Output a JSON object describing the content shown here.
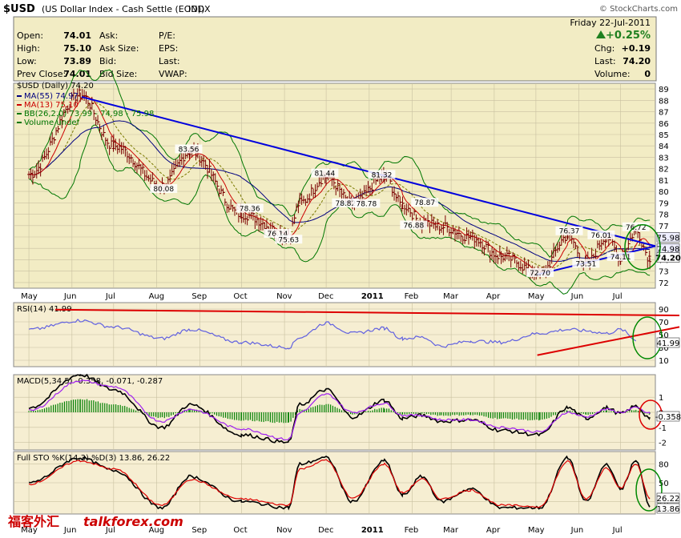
{
  "header": {
    "symbol": "$USD",
    "description": "(US Dollar Index - Cash Settle (EOD))",
    "exchange": "INDX",
    "watermark": "© StockCharts.com",
    "date": "Friday   22-Jul-2011",
    "change_pct": "+0.25%",
    "quote_left": [
      {
        "label": "Open:",
        "value": "74.01"
      },
      {
        "label": "High:",
        "value": "75.10"
      },
      {
        "label": "Low:",
        "value": "73.89"
      },
      {
        "label": "Prev Close:",
        "value": "74.01"
      }
    ],
    "quote_mid": [
      "Ask:",
      "Ask Size:",
      "Bid:",
      "Bid Size:"
    ],
    "quote_mid2": [
      "P/E:",
      "EPS:",
      "Last:",
      "VWAP:"
    ],
    "quote_right": [
      {
        "label": "Chg:",
        "value": "+0.19"
      },
      {
        "label": "Last:",
        "value": "74.20"
      },
      {
        "label": "Volume:",
        "value": "0"
      }
    ]
  },
  "colors": {
    "price_bg": "#f2ecc4",
    "ind_bg": "#f6eed2",
    "bar": "#7a0000",
    "trend_blue": "#0000dd",
    "trend_red": "#dd0000",
    "circle_green": "#008800",
    "circle_red": "#dd0000",
    "ma55": "#000080",
    "ma13": "#cc0000",
    "bb": "#007700",
    "bb_mid": "#7a7a00",
    "rsi": "#6060e0",
    "macd": "#000000",
    "macd_signal": "#a020f0",
    "macd_hist": "#008000",
    "sto_k": "#000000",
    "sto_d": "#dd0000",
    "footer_text": "#cc0000",
    "footer_text2": "#006600"
  },
  "footer": {
    "brand_cn": "福客外汇",
    "brand_en": "talkforex.com"
  },
  "chart_data": [
    {
      "type": "line",
      "title": "$USD (Daily) 74.20",
      "legend": [
        "MA(55) 74.97",
        "MA(13) 75.10",
        "BB(26,2.0) 73.99 - 74.98 - 75.98",
        "Volume undef"
      ],
      "months": [
        "May",
        "Jun",
        "Jul",
        "Aug",
        "Sep",
        "Oct",
        "Nov",
        "Dec",
        "2011",
        "Feb",
        "Mar",
        "Apr",
        "May",
        "Jun",
        "Jul"
      ],
      "y_ticks": [
        72,
        73,
        74,
        75,
        76,
        77,
        78,
        79,
        80,
        81,
        82,
        83,
        84,
        85,
        86,
        87,
        88,
        89
      ],
      "ylim": [
        71.5,
        89.5
      ],
      "series": [
        {
          "name": "$USD (Daily)",
          "x": [
            "2010-05-01",
            "2010-06-07",
            "2010-07-01",
            "2010-08-05",
            "2010-08-25",
            "2010-10-01",
            "2010-11-04",
            "2010-11-12",
            "2010-12-01",
            "2010-12-20",
            "2011-01-12",
            "2011-01-25",
            "2011-02-08",
            "2011-02-22",
            "2011-03-15",
            "2011-04-06",
            "2011-05-04",
            "2011-05-24",
            "2011-06-06",
            "2011-06-21",
            "2011-07-01",
            "2011-07-12",
            "2011-07-22"
          ],
          "values": [
            81.5,
            88.5,
            84,
            80.5,
            83.5,
            78,
            76.2,
            79,
            81.3,
            78.9,
            81.3,
            78.8,
            77.3,
            76.9,
            76.0,
            74.3,
            72.8,
            76.1,
            73.6,
            76.0,
            74.2,
            76.5,
            74.2
          ]
        }
      ],
      "annotations": [
        {
          "text": "83.56",
          "x": "2010-08-24",
          "y": 83.56
        },
        {
          "text": "80.08",
          "x": "2010-08-06",
          "y": 80.08
        },
        {
          "text": "78.36",
          "x": "2010-10-07",
          "y": 78.36
        },
        {
          "text": "76.14",
          "x": "2010-10-27",
          "y": 76.14
        },
        {
          "text": "75.63",
          "x": "2010-11-04",
          "y": 75.63
        },
        {
          "text": "81.44",
          "x": "2010-11-30",
          "y": 81.44
        },
        {
          "text": "78.82",
          "x": "2010-12-15",
          "y": 78.82
        },
        {
          "text": "78.78",
          "x": "2010-12-30",
          "y": 78.78
        },
        {
          "text": "81.32",
          "x": "2011-01-10",
          "y": 81.32
        },
        {
          "text": "78.87",
          "x": "2011-02-10",
          "y": 78.87
        },
        {
          "text": "76.88",
          "x": "2011-02-02",
          "y": 76.88
        },
        {
          "text": "72.70",
          "x": "2011-05-04",
          "y": 72.7
        },
        {
          "text": "76.37",
          "x": "2011-05-25",
          "y": 76.37
        },
        {
          "text": "73.51",
          "x": "2011-06-06",
          "y": 73.51
        },
        {
          "text": "76.01",
          "x": "2011-06-17",
          "y": 76.01
        },
        {
          "text": "74.11",
          "x": "2011-07-01",
          "y": 74.11
        },
        {
          "text": "76.72",
          "x": "2011-07-12",
          "y": 76.72
        }
      ],
      "right_labels": [
        "75.98",
        "74.98",
        "74.20"
      ],
      "trendlines": [
        {
          "color": "blue",
          "from": [
            "2010-06-08",
            88.3
          ],
          "to": [
            "2011-07-26",
            75.2
          ]
        },
        {
          "color": "blue",
          "from": [
            "2011-05-02",
            72.7
          ],
          "to": [
            "2011-07-26",
            75.2
          ]
        }
      ]
    },
    {
      "type": "line",
      "title": "RSI(14) 41.99",
      "y_ticks": [
        10,
        30,
        50,
        70,
        90
      ],
      "ylim": [
        0,
        100
      ],
      "series": [
        {
          "name": "RSI(14)",
          "values": [
            58,
            72,
            62,
            44,
            58,
            38,
            30,
            46,
            68,
            52,
            60,
            44,
            46,
            32,
            40,
            38,
            52,
            58,
            56,
            52,
            58,
            42
          ]
        }
      ],
      "right_labels": [
        "41.99"
      ]
    },
    {
      "type": "line",
      "title": "MACD(5,34,5) -0.358, -0.071, -0.287",
      "y_ticks": [
        -2,
        -1,
        0,
        1
      ],
      "ylim": [
        -2.5,
        2.5
      ],
      "series": [
        {
          "name": "MACD",
          "values": [
            0.3,
            2.5,
            1.5,
            -1.0,
            0.5,
            -1.5,
            -2.0,
            0.5,
            1.5,
            -0.3,
            0.8,
            -0.4,
            -0.2,
            -0.6,
            -0.5,
            -1.2,
            -1.5,
            0.3,
            -0.4,
            0.3,
            -0.1,
            0.4,
            -0.36
          ]
        },
        {
          "name": "signal",
          "values": [
            0.1,
            2.1,
            1.7,
            -0.6,
            0.2,
            -1.1,
            -1.8,
            0.0,
            1.2,
            0.0,
            0.6,
            -0.2,
            -0.2,
            -0.5,
            -0.5,
            -1.0,
            -1.3,
            0.0,
            -0.3,
            0.2,
            0.0,
            0.3,
            -0.07
          ]
        }
      ],
      "right_labels": [
        "-0.358"
      ]
    },
    {
      "type": "line",
      "title": "Full STO %K(14,3) %D(3) 13.86, 26.22",
      "y_ticks": [
        20,
        50,
        80
      ],
      "ylim": [
        0,
        100
      ],
      "series": [
        {
          "name": "%K",
          "values": [
            50,
            90,
            70,
            10,
            60,
            20,
            10,
            80,
            90,
            20,
            85,
            30,
            60,
            20,
            40,
            10,
            10,
            90,
            20,
            80,
            40,
            85,
            14
          ]
        },
        {
          "name": "%D",
          "values": [
            48,
            85,
            72,
            14,
            55,
            24,
            14,
            72,
            86,
            25,
            80,
            34,
            56,
            24,
            38,
            14,
            12,
            84,
            24,
            74,
            42,
            80,
            26
          ]
        }
      ],
      "right_labels": [
        "26.22",
        "13.86"
      ]
    }
  ]
}
